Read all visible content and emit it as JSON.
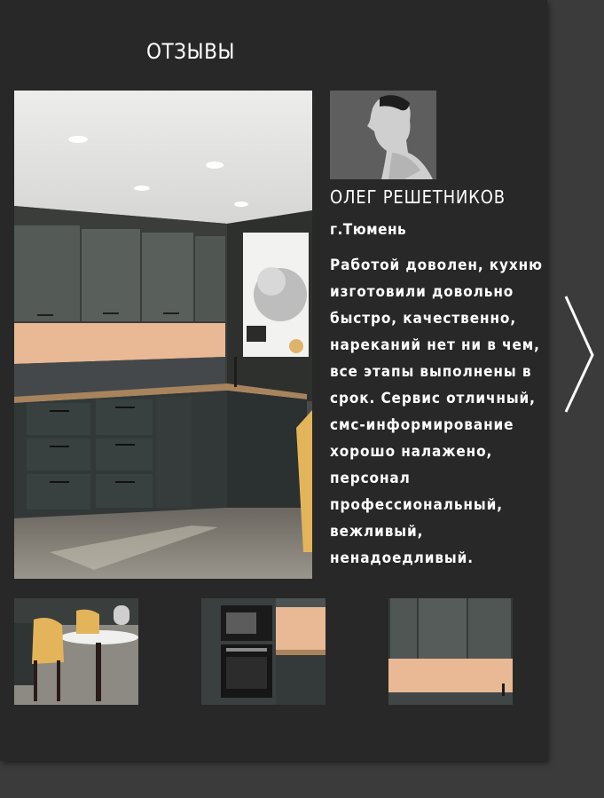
{
  "section": {
    "title": "ОТЗЫВЫ"
  },
  "review": {
    "name": "ОЛЕГ РЕШЕТНИКОВ",
    "city": "г.Тюмень",
    "text": "Работой доволен, кухню изготовили довольно быстро, качественно, нареканий нет ни в чем, все этапы выполнены в срок. Сервис отличный, смс-информирование хорошо налажено, персонал профессиональный, вежливый, ненадоедливый."
  },
  "navigation": {
    "next_icon": "chevron-right-icon"
  },
  "colors": {
    "panel": "#282828",
    "page": "#3b3b3b",
    "text": "#ffffff",
    "accent_backsplash": "#e8b994"
  }
}
